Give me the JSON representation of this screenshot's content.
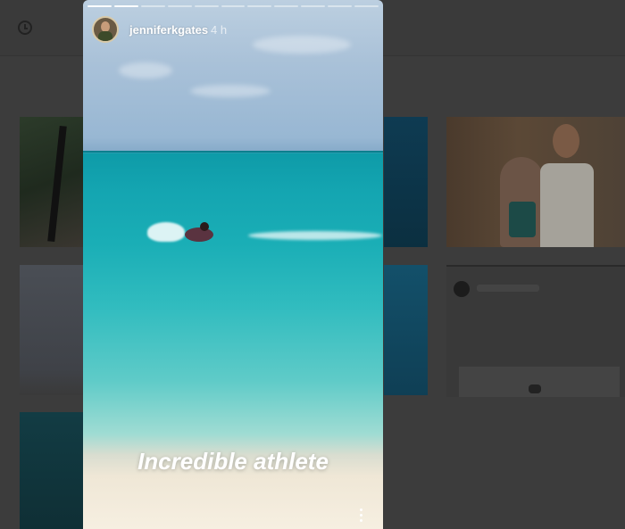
{
  "story": {
    "username": "jenniferkgates",
    "time": "4 h",
    "caption": "Incredible athlete",
    "progress": {
      "total_segments": 11,
      "completed_segments": 2
    }
  },
  "icons": {
    "clock": "clock-icon",
    "more": "more-options-icon",
    "avatar": "profile-avatar"
  }
}
